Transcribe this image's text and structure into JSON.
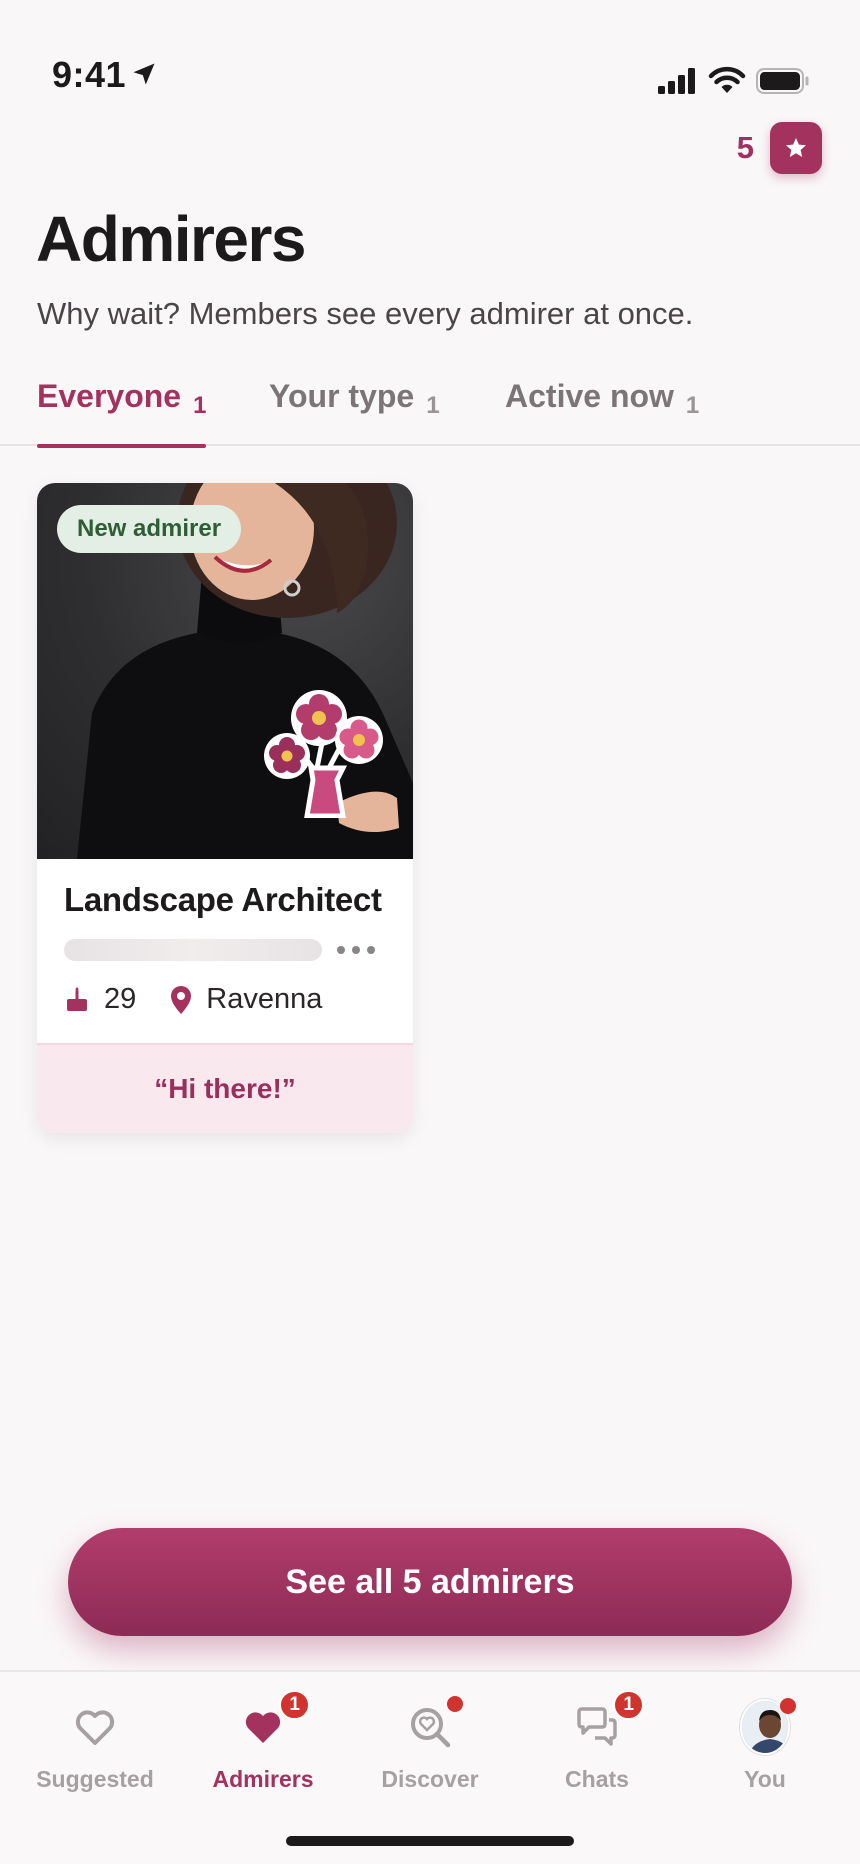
{
  "status_bar": {
    "time": "9:41"
  },
  "credits": {
    "count": "5",
    "icon": "star-icon"
  },
  "header": {
    "title": "Admirers",
    "subtitle": "Why wait? Members see every admirer at once."
  },
  "tabs": [
    {
      "label": "Everyone",
      "count": "1",
      "active": true
    },
    {
      "label": "Your type",
      "count": "1",
      "active": false
    },
    {
      "label": "Active now",
      "count": "1",
      "active": false
    }
  ],
  "card": {
    "badge": "New admirer",
    "name": "Landscape Architect",
    "age": "29",
    "location": "Ravenna",
    "message": "“Hi there!”",
    "sticker": "flower-vase-icon"
  },
  "cta": {
    "label": "See all 5 admirers"
  },
  "nav": [
    {
      "label": "Suggested",
      "icon": "heart-outline-icon",
      "badge": ""
    },
    {
      "label": "Admirers",
      "icon": "heart-filled-icon",
      "badge": "1",
      "active": true
    },
    {
      "label": "Discover",
      "icon": "search-heart-icon",
      "badge": "dot"
    },
    {
      "label": "Chats",
      "icon": "chat-bubbles-icon",
      "badge": "1"
    },
    {
      "label": "You",
      "icon": "avatar",
      "badge": "dot"
    }
  ],
  "colors": {
    "accent": "#a3325f",
    "badge_red": "#d1332f",
    "new_badge_bg": "#e3efe4",
    "footer_bg": "#f9e9ef"
  }
}
